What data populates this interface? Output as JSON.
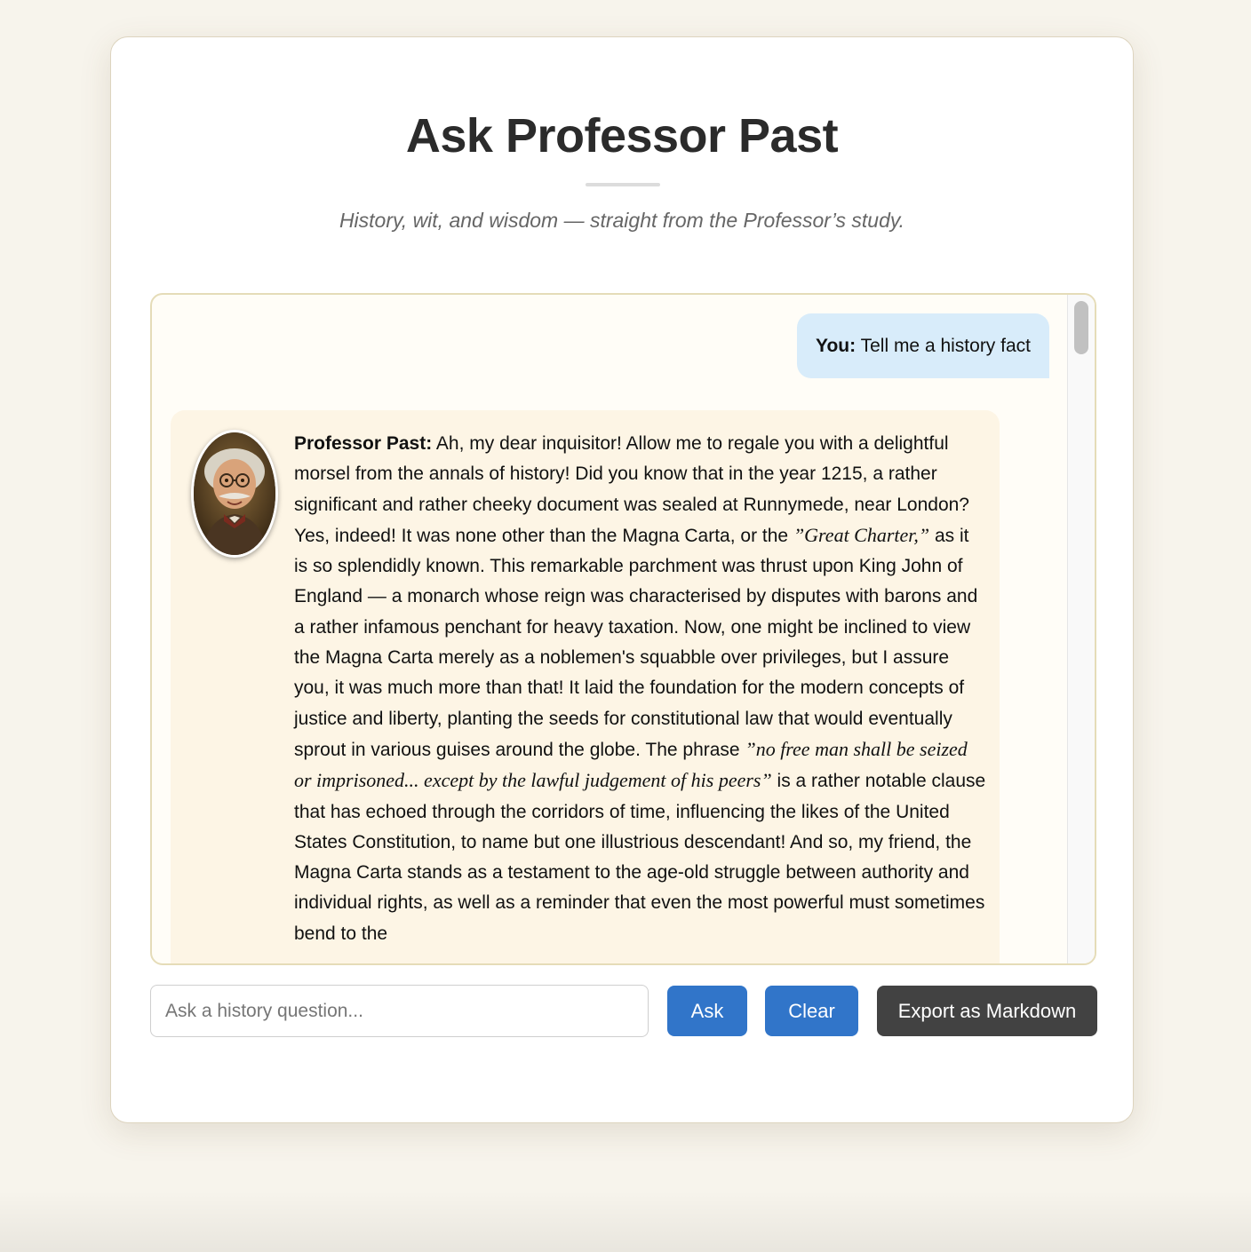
{
  "header": {
    "title": "Ask Professor Past",
    "subtitle": "History, wit, and wisdom — straight from the Professor’s study."
  },
  "chat": {
    "user_message": {
      "speaker": "You:",
      "text": "Tell me a history fact"
    },
    "bot_message": {
      "speaker": "Professor Past:",
      "part1": "Ah, my dear inquisitor! Allow me to regale you with a delightful morsel from the annals of history! Did you know that in the year 1215, a rather significant and rather cheeky document was sealed at Runnymede, near London? Yes, indeed! It was none other than the Magna Carta, or the",
      "quote1": "”Great Charter,”",
      "part2": "as it is so splendidly known. This remarkable parchment was thrust upon King John of England — a monarch whose reign was characterised by disputes with barons and a rather infamous penchant for heavy taxation. Now, one might be inclined to view the Magna Carta merely as a noblemen's squabble over privileges, but I assure you, it was much more than that! It laid the foundation for the modern concepts of justice and liberty, planting the seeds for constitutional law that would eventually sprout in various guises around the globe. The phrase",
      "quote2": "”no free man shall be seized or imprisoned... except by the lawful judgement of his peers”",
      "part3": "is a rather notable clause that has echoed through the corridors of time, influencing the likes of the United States Constitution, to name but one illustrious descendant! And so, my friend, the Magna Carta stands as a testament to the age-old struggle between authority and individual rights, as well as a reminder that even the most powerful must sometimes bend to the"
    }
  },
  "composer": {
    "placeholder": "Ask a history question...",
    "ask_label": "Ask",
    "clear_label": "Clear",
    "export_label": "Export as Markdown"
  },
  "colors": {
    "page_background": "#f7f4ec",
    "user_bubble": "#d8ecfa",
    "bot_bubble": "#fdf5e5",
    "primary_button": "#3175c9",
    "export_button": "#424242"
  }
}
